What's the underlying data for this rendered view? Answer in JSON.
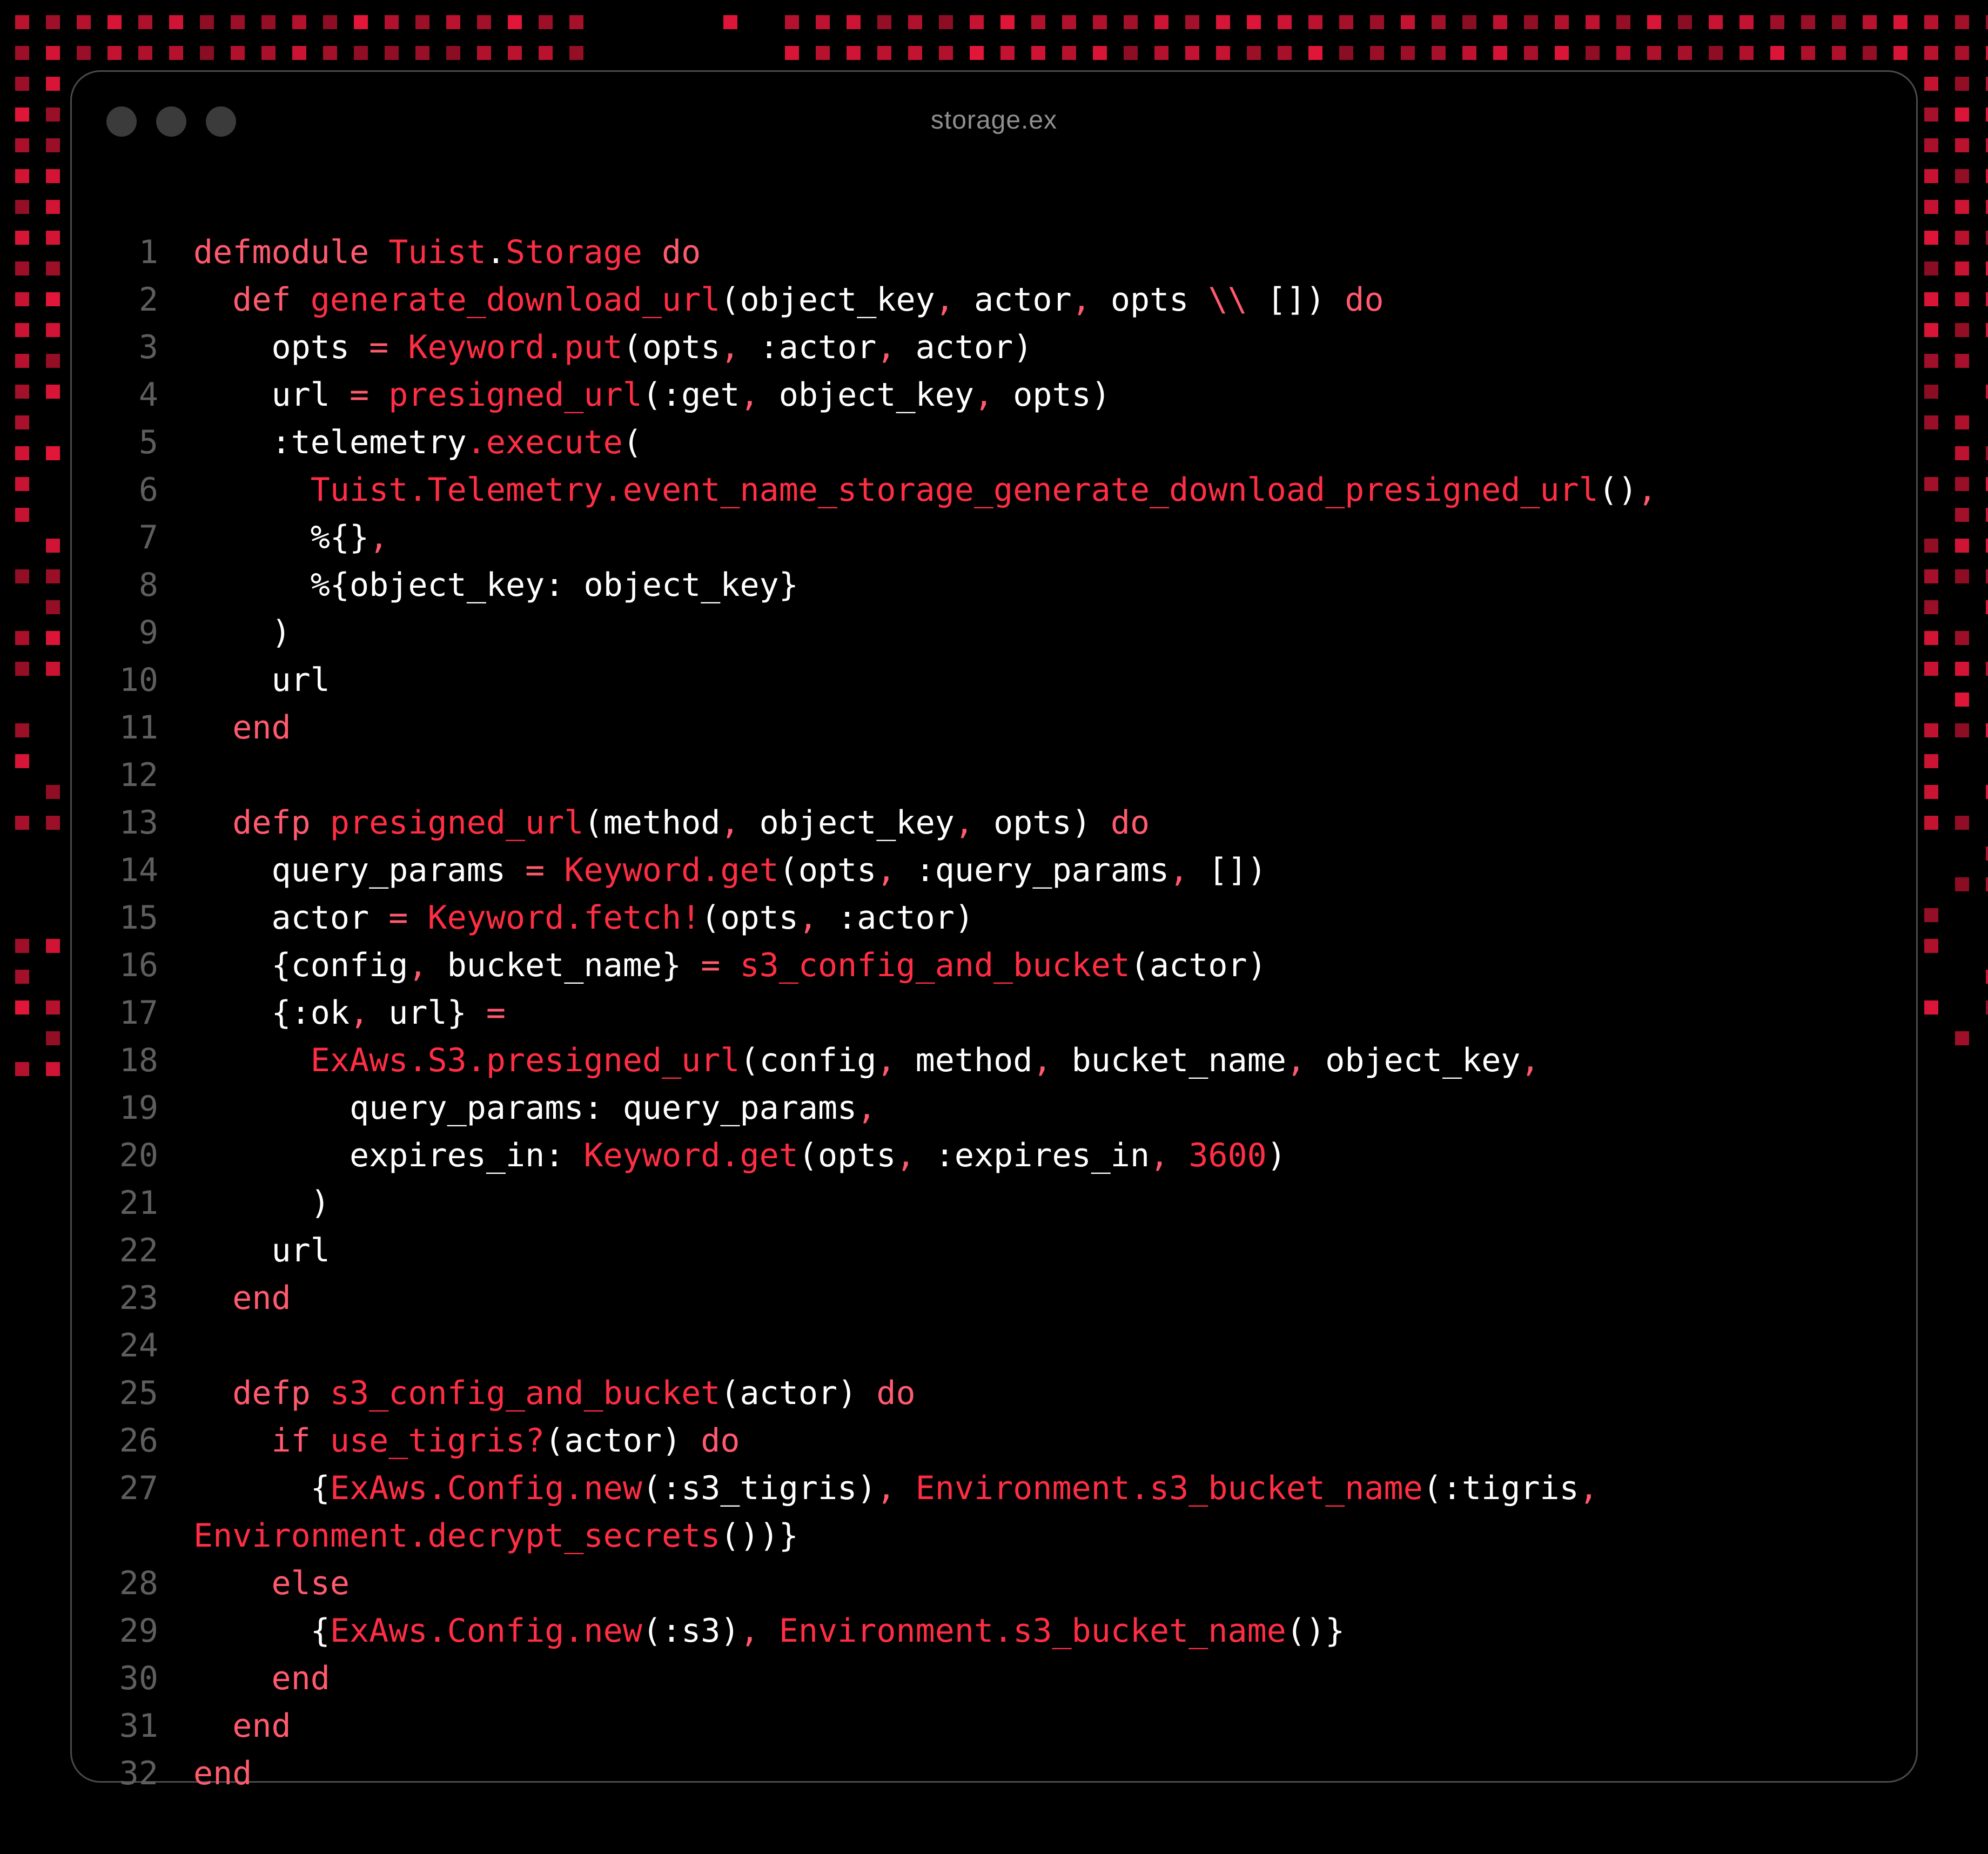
{
  "colors": {
    "background": "#000000",
    "window_border": "#4a4a4a",
    "keyword": "#ff5a6e",
    "function": "#ff2e44",
    "plain": "#ffffff",
    "line_number": "#5e5e5e",
    "title": "#8f8f8f",
    "dot_accent": "#e4163a"
  },
  "window": {
    "title": "storage.ex",
    "buttons": [
      {
        "name": "close-button",
        "icon": "circle-icon"
      },
      {
        "name": "minimize-button",
        "icon": "circle-icon"
      },
      {
        "name": "zoom-button",
        "icon": "circle-icon"
      }
    ]
  },
  "editor": {
    "language": "elixir",
    "lines": [
      {
        "num": "1",
        "tokens": [
          [
            "kw",
            "defmodule "
          ],
          [
            "fn",
            "Tuist"
          ],
          [
            "plain",
            "."
          ],
          [
            "fn",
            "Storage"
          ],
          [
            "kw",
            " do"
          ]
        ]
      },
      {
        "num": "2",
        "tokens": [
          [
            "plain",
            "  "
          ],
          [
            "kw",
            "def "
          ],
          [
            "fn",
            "generate_download_url"
          ],
          [
            "plain",
            "(object_key"
          ],
          [
            "punct",
            ", "
          ],
          [
            "plain",
            "actor"
          ],
          [
            "punct",
            ", "
          ],
          [
            "plain",
            "opts "
          ],
          [
            "kw",
            "\\\\"
          ],
          [
            "plain",
            " []) "
          ],
          [
            "kw",
            "do"
          ]
        ]
      },
      {
        "num": "3",
        "tokens": [
          [
            "plain",
            "    opts "
          ],
          [
            "kw",
            "= "
          ],
          [
            "fn",
            "Keyword.put"
          ],
          [
            "plain",
            "(opts"
          ],
          [
            "punct",
            ", "
          ],
          [
            "plain",
            ":actor"
          ],
          [
            "punct",
            ", "
          ],
          [
            "plain",
            "actor)"
          ]
        ]
      },
      {
        "num": "4",
        "tokens": [
          [
            "plain",
            "    url "
          ],
          [
            "kw",
            "= "
          ],
          [
            "fn",
            "presigned_url"
          ],
          [
            "plain",
            "(:get"
          ],
          [
            "punct",
            ", "
          ],
          [
            "plain",
            "object_key"
          ],
          [
            "punct",
            ", "
          ],
          [
            "plain",
            "opts)"
          ]
        ]
      },
      {
        "num": "5",
        "tokens": [
          [
            "plain",
            "    :telemetry"
          ],
          [
            "fn",
            ".execute"
          ],
          [
            "plain",
            "("
          ]
        ]
      },
      {
        "num": "6",
        "tokens": [
          [
            "plain",
            "      "
          ],
          [
            "fn",
            "Tuist.Telemetry.event_name_storage_generate_download_presigned_url"
          ],
          [
            "plain",
            "()"
          ],
          [
            "punct",
            ","
          ]
        ]
      },
      {
        "num": "7",
        "tokens": [
          [
            "plain",
            "      %{}"
          ],
          [
            "punct",
            ","
          ]
        ]
      },
      {
        "num": "8",
        "tokens": [
          [
            "plain",
            "      %{object_key: object_key}"
          ]
        ]
      },
      {
        "num": "9",
        "tokens": [
          [
            "plain",
            "    )"
          ]
        ]
      },
      {
        "num": "10",
        "tokens": [
          [
            "plain",
            "    url"
          ]
        ]
      },
      {
        "num": "11",
        "tokens": [
          [
            "plain",
            "  "
          ],
          [
            "kw",
            "end"
          ]
        ]
      },
      {
        "num": "12",
        "tokens": []
      },
      {
        "num": "13",
        "tokens": [
          [
            "plain",
            "  "
          ],
          [
            "kw",
            "defp "
          ],
          [
            "fn",
            "presigned_url"
          ],
          [
            "plain",
            "(method"
          ],
          [
            "punct",
            ", "
          ],
          [
            "plain",
            "object_key"
          ],
          [
            "punct",
            ", "
          ],
          [
            "plain",
            "opts) "
          ],
          [
            "kw",
            "do"
          ]
        ]
      },
      {
        "num": "14",
        "tokens": [
          [
            "plain",
            "    query_params "
          ],
          [
            "kw",
            "= "
          ],
          [
            "fn",
            "Keyword.get"
          ],
          [
            "plain",
            "(opts"
          ],
          [
            "punct",
            ", "
          ],
          [
            "plain",
            ":query_params"
          ],
          [
            "punct",
            ", "
          ],
          [
            "plain",
            "[])"
          ]
        ]
      },
      {
        "num": "15",
        "tokens": [
          [
            "plain",
            "    actor "
          ],
          [
            "kw",
            "= "
          ],
          [
            "fn",
            "Keyword.fetch!"
          ],
          [
            "plain",
            "(opts"
          ],
          [
            "punct",
            ", "
          ],
          [
            "plain",
            ":actor)"
          ]
        ]
      },
      {
        "num": "16",
        "tokens": [
          [
            "plain",
            "    {config"
          ],
          [
            "punct",
            ", "
          ],
          [
            "plain",
            "bucket_name} "
          ],
          [
            "kw",
            "= "
          ],
          [
            "fn",
            "s3_config_and_bucket"
          ],
          [
            "plain",
            "(actor)"
          ]
        ]
      },
      {
        "num": "17",
        "tokens": [
          [
            "plain",
            "    {:ok"
          ],
          [
            "punct",
            ", "
          ],
          [
            "plain",
            "url} "
          ],
          [
            "kw",
            "="
          ]
        ]
      },
      {
        "num": "18",
        "tokens": [
          [
            "plain",
            "      "
          ],
          [
            "fn",
            "ExAws.S3.presigned_url"
          ],
          [
            "plain",
            "(config"
          ],
          [
            "punct",
            ", "
          ],
          [
            "plain",
            "method"
          ],
          [
            "punct",
            ", "
          ],
          [
            "plain",
            "bucket_name"
          ],
          [
            "punct",
            ", "
          ],
          [
            "plain",
            "object_key"
          ],
          [
            "punct",
            ","
          ]
        ]
      },
      {
        "num": "19",
        "tokens": [
          [
            "plain",
            "        query_params: query_params"
          ],
          [
            "punct",
            ","
          ]
        ]
      },
      {
        "num": "20",
        "tokens": [
          [
            "plain",
            "        expires_in: "
          ],
          [
            "fn",
            "Keyword.get"
          ],
          [
            "plain",
            "(opts"
          ],
          [
            "punct",
            ", "
          ],
          [
            "plain",
            ":expires_in"
          ],
          [
            "punct",
            ", "
          ],
          [
            "num",
            "3600"
          ],
          [
            "plain",
            ")"
          ]
        ]
      },
      {
        "num": "21",
        "tokens": [
          [
            "plain",
            "      )"
          ]
        ]
      },
      {
        "num": "22",
        "tokens": [
          [
            "plain",
            "    url"
          ]
        ]
      },
      {
        "num": "23",
        "tokens": [
          [
            "plain",
            "  "
          ],
          [
            "kw",
            "end"
          ]
        ]
      },
      {
        "num": "24",
        "tokens": []
      },
      {
        "num": "25",
        "tokens": [
          [
            "plain",
            "  "
          ],
          [
            "kw",
            "defp "
          ],
          [
            "fn",
            "s3_config_and_bucket"
          ],
          [
            "plain",
            "(actor) "
          ],
          [
            "kw",
            "do"
          ]
        ]
      },
      {
        "num": "26",
        "tokens": [
          [
            "plain",
            "    "
          ],
          [
            "kw",
            "if "
          ],
          [
            "fn",
            "use_tigris?"
          ],
          [
            "plain",
            "(actor) "
          ],
          [
            "kw",
            "do"
          ]
        ]
      },
      {
        "num": "27",
        "tokens": [
          [
            "plain",
            "      {"
          ],
          [
            "fn",
            "ExAws.Config.new"
          ],
          [
            "plain",
            "(:s3_tigris)"
          ],
          [
            "punct",
            ", "
          ],
          [
            "fn",
            "Environment.s3_bucket_name"
          ],
          [
            "plain",
            "(:tigris"
          ],
          [
            "punct",
            ","
          ]
        ]
      },
      {
        "num": "",
        "tokens": [
          [
            "fn",
            "Environment.decrypt_secrets"
          ],
          [
            "plain",
            "())}"
          ]
        ]
      },
      {
        "num": "28",
        "tokens": [
          [
            "plain",
            "    "
          ],
          [
            "kw",
            "else"
          ]
        ]
      },
      {
        "num": "29",
        "tokens": [
          [
            "plain",
            "      {"
          ],
          [
            "fn",
            "ExAws.Config.new"
          ],
          [
            "plain",
            "(:s3)"
          ],
          [
            "punct",
            ", "
          ],
          [
            "fn",
            "Environment.s3_bucket_name"
          ],
          [
            "plain",
            "()}"
          ]
        ]
      },
      {
        "num": "30",
        "tokens": [
          [
            "plain",
            "    "
          ],
          [
            "kw",
            "end"
          ]
        ]
      },
      {
        "num": "31",
        "tokens": [
          [
            "plain",
            "  "
          ],
          [
            "kw",
            "end"
          ]
        ]
      },
      {
        "num": "32",
        "tokens": [
          [
            "kw",
            "end"
          ]
        ]
      }
    ]
  }
}
